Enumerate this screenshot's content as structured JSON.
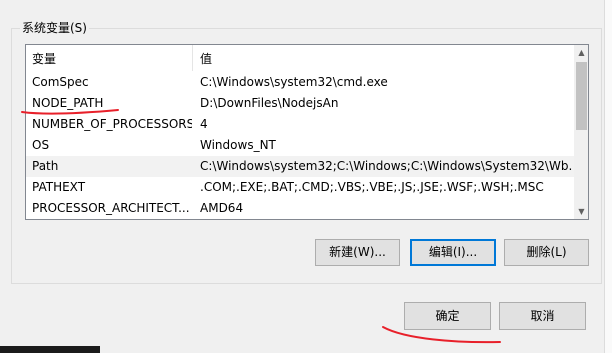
{
  "group": {
    "title": "系统变量(S)"
  },
  "table": {
    "headers": [
      "变量",
      "值"
    ],
    "rows": [
      {
        "name": "ComSpec",
        "value": "C:\\Windows\\system32\\cmd.exe"
      },
      {
        "name": "NODE_PATH",
        "value": "D:\\DownFiles\\NodejsAn"
      },
      {
        "name": "NUMBER_OF_PROCESSORS",
        "value": "4"
      },
      {
        "name": "OS",
        "value": "Windows_NT"
      },
      {
        "name": "Path",
        "value": "C:\\Windows\\system32;C:\\Windows;C:\\Windows\\System32\\Wb..."
      },
      {
        "name": "PATHEXT",
        "value": ".COM;.EXE;.BAT;.CMD;.VBS;.VBE;.JS;.JSE;.WSF;.WSH;.MSC"
      },
      {
        "name": "PROCESSOR_ARCHITECT...",
        "value": "AMD64"
      }
    ],
    "selected_row": 4
  },
  "buttons": {
    "new": "新建(W)...",
    "edit": "编辑(I)...",
    "delete": "删除(L)"
  },
  "dialog_buttons": {
    "ok": "确定",
    "cancel": "取消"
  },
  "icons": {
    "scroll_up": "▲",
    "scroll_down": "▼"
  },
  "colors": {
    "annotation": "#e8202a",
    "focus": "#0078d7"
  }
}
